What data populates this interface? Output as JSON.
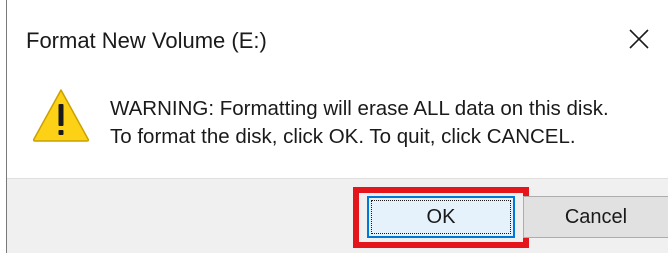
{
  "dialog": {
    "title": "Format New Volume (E:)",
    "close_icon": "close-icon",
    "warning_icon": "warning-triangle-icon",
    "message_line1": "WARNING: Formatting will erase ALL data on this disk.",
    "message_line2": "To format the disk, click OK. To quit, click CANCEL.",
    "ok_label": "OK",
    "cancel_label": "Cancel"
  },
  "colors": {
    "highlight": "#e4151b",
    "focus_border": "#0078d7",
    "warning_fill": "#fcd116",
    "footer_bg": "#f0f0f0"
  }
}
